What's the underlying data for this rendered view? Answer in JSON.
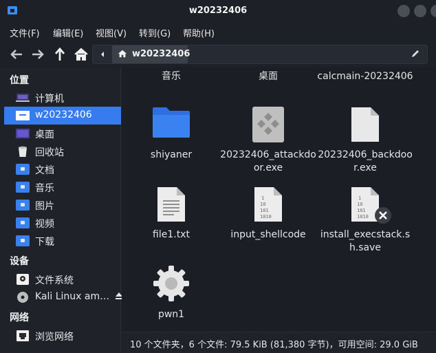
{
  "window": {
    "title": "w20232406"
  },
  "menu": {
    "items": [
      "文件(F)",
      "编辑(E)",
      "视图(V)",
      "转到(G)",
      "帮助(H)"
    ]
  },
  "toolbar": {
    "breadcrumb": "w20232406"
  },
  "sidebar": {
    "sections": [
      {
        "header": "位置",
        "items": [
          {
            "label": "计算机",
            "icon": "computer-icon"
          },
          {
            "label": "w20232406",
            "icon": "home-folder-icon",
            "selected": true
          },
          {
            "label": "桌面",
            "icon": "desktop-icon"
          },
          {
            "label": "回收站",
            "icon": "trash-icon"
          },
          {
            "label": "文档",
            "icon": "documents-folder-icon"
          },
          {
            "label": "音乐",
            "icon": "music-folder-icon"
          },
          {
            "label": "图片",
            "icon": "pictures-folder-icon"
          },
          {
            "label": "视频",
            "icon": "videos-folder-icon"
          },
          {
            "label": "下载",
            "icon": "downloads-folder-icon"
          }
        ]
      },
      {
        "header": "设备",
        "items": [
          {
            "label": "文件系统",
            "icon": "drive-icon"
          },
          {
            "label": "Kali Linux am…",
            "icon": "disc-icon"
          }
        ]
      },
      {
        "header": "网络",
        "items": [
          {
            "label": "浏览网络",
            "icon": "network-icon"
          }
        ]
      }
    ]
  },
  "files": {
    "partial_row": [
      "音乐",
      "桌面",
      "calcmain-20232406"
    ],
    "items": [
      {
        "name": "shiyaner",
        "icon": "folder-icon"
      },
      {
        "name": "20232406_attackdoor.exe",
        "icon": "exe-icon"
      },
      {
        "name": "20232406_backdoor.exe",
        "icon": "blank-file-icon"
      },
      {
        "name": "file1.txt",
        "icon": "text-file-icon"
      },
      {
        "name": "input_shellcode",
        "icon": "binary-file-icon"
      },
      {
        "name": "install_execstack.sh.save",
        "icon": "binary-file-icon"
      },
      {
        "name": "pwn1",
        "icon": "executable-gear-icon"
      }
    ]
  },
  "status": {
    "text": "10 个文件夹，6 个文件: 79.5 KiB (81,380 字节)，可用空间: 29.0 GiB"
  }
}
